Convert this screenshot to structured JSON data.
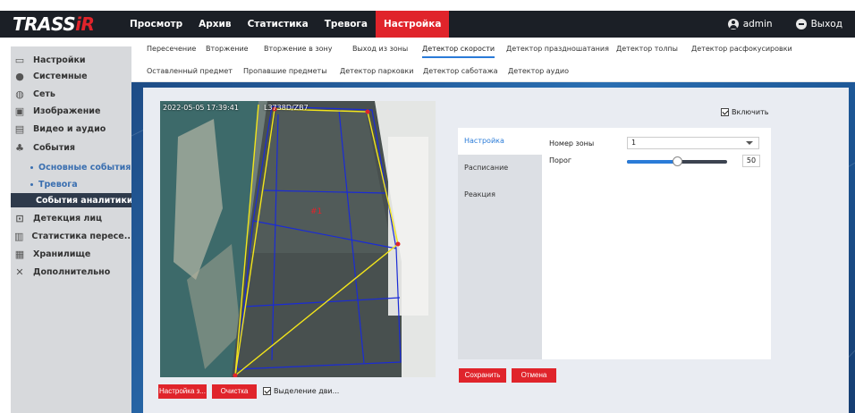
{
  "brand": {
    "logo_main": "TRASS",
    "logo_accent": "iR"
  },
  "topnav": [
    "Просмотр",
    "Архив",
    "Статистика",
    "Тревога",
    "Настройка"
  ],
  "topnav_active": 4,
  "user": {
    "name": "admin",
    "logout": "Выход"
  },
  "sidebar": {
    "items": [
      {
        "icon": "monitor-icon",
        "label": "Настройки"
      },
      {
        "icon": "info-icon",
        "label": "Системные"
      },
      {
        "icon": "globe-icon",
        "label": "Сеть"
      },
      {
        "icon": "image-icon",
        "label": "Изображение"
      },
      {
        "icon": "video-icon",
        "label": "Видео и аудио"
      },
      {
        "icon": "bell-icon",
        "label": "События"
      }
    ],
    "sub_items": [
      "Основные события",
      "Тревога",
      "События аналитики"
    ],
    "lower_items": [
      {
        "icon": "face-icon",
        "label": "Детекция лиц"
      },
      {
        "icon": "chart-icon",
        "label": "Статистика пересе..."
      },
      {
        "icon": "disk-icon",
        "label": "Хранилище"
      },
      {
        "icon": "tools-icon",
        "label": "Дополнительно"
      }
    ]
  },
  "subtabs": {
    "row1": [
      "Пересечение",
      "Вторжение",
      "Вторжение в зону",
      "Выход из зоны",
      "Детектор скорости",
      "Детектор праздношатания",
      "Детектор толпы",
      "Детектор расфокусировки"
    ],
    "row2": [
      "Оставленный предмет",
      "Пропавшие предметы",
      "Детектор парковки",
      "Детектор саботажа",
      "Детектор аудио"
    ],
    "active": "Детектор скорости"
  },
  "video": {
    "timestamp": "2022-05-05 17:39:41",
    "camera_name": "L3738D/ZB7",
    "zone_label": "#1"
  },
  "video_controls": {
    "setup": "Настройка з...",
    "clear": "Очистка",
    "motion": "Выделение дви..."
  },
  "enable": {
    "label": "Включить",
    "checked": true
  },
  "settings_tabs": [
    "Настройка",
    "Расписание",
    "Реакция"
  ],
  "settings_active": 0,
  "fields": {
    "zone_label": "Номер зоны",
    "zone_value": "1",
    "threshold_label": "Порог",
    "threshold_value": "50",
    "threshold_fraction": 0.5
  },
  "actions": {
    "save": "Сохранить",
    "cancel": "Отмена"
  },
  "colors": {
    "accent": "#e0242b",
    "link": "#2a7bd8",
    "topbar": "#1b1f26"
  }
}
